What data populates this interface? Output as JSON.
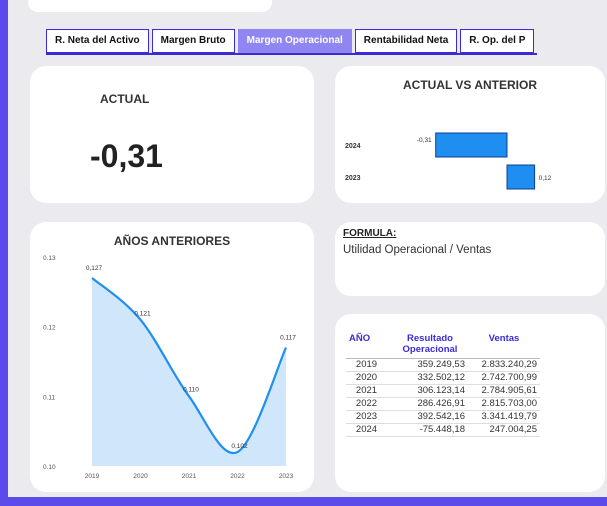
{
  "tabs": [
    {
      "label": "R. Neta del Activo",
      "active": false
    },
    {
      "label": "Margen Bruto",
      "active": false
    },
    {
      "label": "Margen Operacional",
      "active": true
    },
    {
      "label": "Rentabilidad Neta",
      "active": false
    },
    {
      "label": "R. Op. del P",
      "active": false
    }
  ],
  "actual_card": {
    "label": "ACTUAL",
    "value": "-0,31"
  },
  "comparison_card": {
    "title": "ACTUAL VS ANTERIOR"
  },
  "history_card": {
    "title": "AÑOS ANTERIORES"
  },
  "formula_card": {
    "label": "FORMULA:",
    "text": "Utilidad Operacional / Ventas"
  },
  "table": {
    "headers": [
      "AÑO",
      "Resultado Operacional",
      "Ventas"
    ],
    "rows": [
      [
        "2019",
        "359.249,53",
        "2.833.240,29"
      ],
      [
        "2020",
        "332.502,12",
        "2.742.700,99"
      ],
      [
        "2021",
        "306.123,14",
        "2.784.905,61"
      ],
      [
        "2022",
        "286.426,91",
        "2.815.703,00"
      ],
      [
        "2023",
        "392.542,16",
        "3.341.419,79"
      ],
      [
        "2024",
        "-75.448,18",
        "247.004,25"
      ]
    ]
  },
  "colors": {
    "accent": "#3b2bd6",
    "bar": "#1e8ff0",
    "line": "#1e8ff0",
    "area": "#cfe6fb",
    "background": "#5a4bea"
  },
  "chart_data": [
    {
      "type": "bar",
      "orientation": "horizontal",
      "title": "ACTUAL VS ANTERIOR",
      "categories": [
        "2024",
        "2023"
      ],
      "values": [
        -0.31,
        0.12
      ],
      "value_labels": [
        "-0,31",
        "0,12"
      ]
    },
    {
      "type": "area",
      "title": "AÑOS ANTERIORES",
      "x": [
        "2019",
        "2020",
        "2021",
        "2022",
        "2023"
      ],
      "values": [
        0.127,
        0.121,
        0.11,
        0.102,
        0.117
      ],
      "value_labels": [
        "0,127",
        "0,121",
        "0,110",
        "0,102",
        "0,117"
      ],
      "y_ticks": [
        "0.13",
        "0.12",
        "0.11",
        "0.10"
      ],
      "ylim": [
        0.1,
        0.13
      ]
    }
  ]
}
